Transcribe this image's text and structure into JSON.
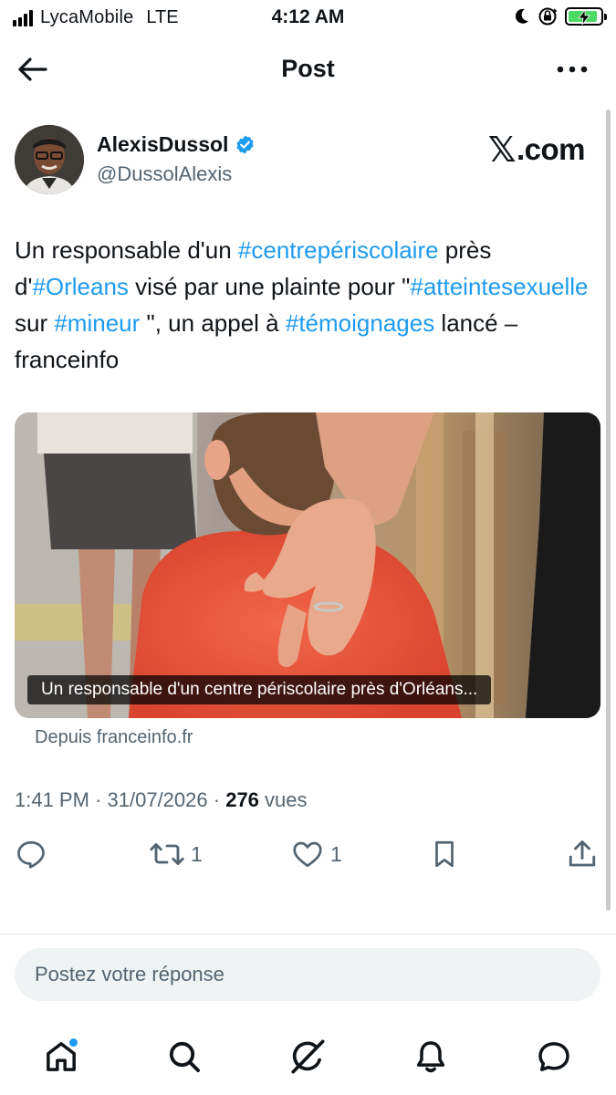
{
  "status_bar": {
    "carrier": "LycaMobile",
    "network": "LTE",
    "time": "4:12 AM",
    "battery_level": 0.9,
    "icons": [
      "signal-icon",
      "moon-icon",
      "orientation-lock-icon",
      "battery-charging-icon"
    ]
  },
  "header": {
    "title": "Post",
    "back_icon": "arrow-left-icon",
    "more_icon": "more-horizontal-icon"
  },
  "author": {
    "name": "AlexisDussol",
    "handle": "@DussolAlexis",
    "verified": true,
    "watermark": ".com"
  },
  "tweet": {
    "segments": [
      {
        "text": "Un responsable d'un ",
        "tag": false
      },
      {
        "text": "#centrepériscolaire",
        "tag": true
      },
      {
        "text": " près d'",
        "tag": false
      },
      {
        "text": "#Orleans",
        "tag": true
      },
      {
        "text": " visé par une plainte pour \"",
        "tag": false
      },
      {
        "text": "#atteintesexuelle",
        "tag": true
      },
      {
        "text": " sur ",
        "tag": false
      },
      {
        "text": "#mineur",
        "tag": true
      },
      {
        "text": " \", un appel à ",
        "tag": false
      },
      {
        "text": "#témoignages",
        "tag": true
      },
      {
        "text": " lancé – franceinfo",
        "tag": false
      }
    ]
  },
  "card": {
    "caption": "Un responsable d'un centre périscolaire près d'Orléans...",
    "source": "Depuis franceinfo.fr"
  },
  "meta": {
    "time": "1:41 PM",
    "separator": "·",
    "date": "31/07/2026",
    "views_count": "276",
    "views_label": "vues"
  },
  "actions": {
    "reply": {
      "icon": "reply-icon",
      "count": ""
    },
    "retweet": {
      "icon": "retweet-icon",
      "count": "1"
    },
    "like": {
      "icon": "heart-icon",
      "count": "1"
    },
    "bookmark": {
      "icon": "bookmark-icon",
      "count": ""
    },
    "share": {
      "icon": "share-icon",
      "count": ""
    }
  },
  "reply_box": {
    "placeholder": "Postez votre réponse"
  },
  "bottom_nav": {
    "items": [
      "home-icon",
      "search-icon",
      "grok-icon",
      "notifications-icon",
      "messages-icon"
    ],
    "home_has_notification_dot": true
  },
  "colors": {
    "accent": "#1d9bf0",
    "text": "#0f1419",
    "secondary": "#536471"
  }
}
